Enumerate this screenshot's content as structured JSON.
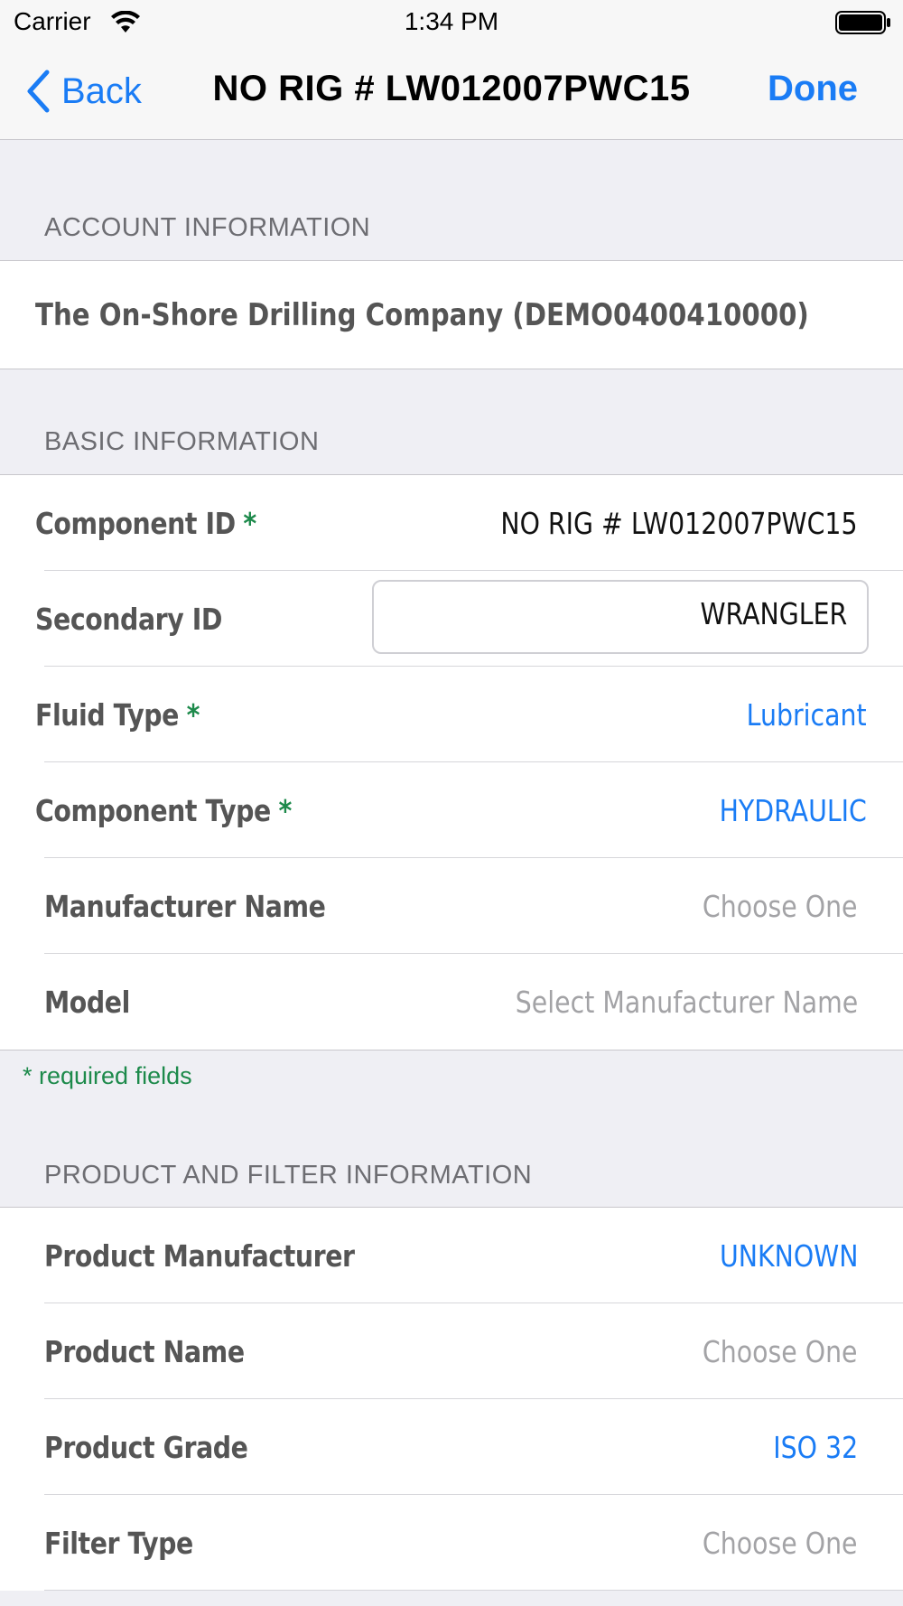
{
  "status_bar": {
    "carrier": "Carrier",
    "time": "1:34 PM"
  },
  "nav": {
    "back_label": "Back",
    "title": "NO RIG # LW012007PWC15",
    "done_label": "Done"
  },
  "account": {
    "header": "ACCOUNT INFORMATION",
    "company": "The On-Shore Drilling Company (DEMO0400410000)"
  },
  "basic": {
    "header": "BASIC INFORMATION",
    "rows": [
      {
        "label": "Component ID",
        "required": "*",
        "value": "NO RIG # LW012007PWC15"
      },
      {
        "label": "Secondary ID",
        "value": "WRANGLER"
      },
      {
        "label": "Fluid Type",
        "required": "*",
        "value": "Lubricant"
      },
      {
        "label": "Component Type",
        "required": "*",
        "value": "HYDRAULIC"
      },
      {
        "label": "Manufacturer Name",
        "value": "Choose One"
      },
      {
        "label": "Model",
        "value": "Select Manufacturer Name"
      }
    ],
    "footnote": "* required fields"
  },
  "product": {
    "header": "PRODUCT AND FILTER INFORMATION",
    "rows": [
      {
        "label": "Product Manufacturer",
        "value": "UNKNOWN"
      },
      {
        "label": "Product Name",
        "value": "Choose One"
      },
      {
        "label": "Product Grade",
        "value": "ISO 32"
      },
      {
        "label": "Filter Type",
        "value": "Choose One"
      }
    ]
  },
  "colors": {
    "accent": "#1a7cf5",
    "required": "#1d8a4b",
    "placeholder": "#a3a3a6",
    "background": "#efeff4"
  }
}
